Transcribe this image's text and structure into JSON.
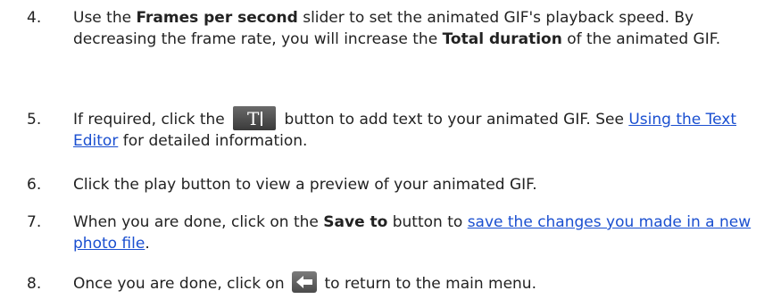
{
  "steps": [
    {
      "number": "4.",
      "parts": [
        "Use the ",
        "Frames per second",
        " slider to set the animated GIF's playback speed. By decreasing the frame rate, you will increase the ",
        "Total duration",
        " of the animated GIF."
      ]
    },
    {
      "number": "5.",
      "parts": [
        "If required, click the ",
        " button to add text to your animated GIF. See ",
        "Using the Text Editor",
        " for detailed information."
      ],
      "icon": "text-tool-icon"
    },
    {
      "number": "6.",
      "parts": [
        "Click the play button to view a preview of your animated GIF."
      ]
    },
    {
      "number": "7.",
      "parts": [
        "When you are done, click on the ",
        "Save to",
        " button to ",
        "save the changes you made in a new photo file",
        "."
      ]
    },
    {
      "number": "8.",
      "parts": [
        "Once you are done, click on ",
        " to return to the main menu."
      ],
      "icon": "back-arrow-icon"
    }
  ],
  "colors": {
    "text": "#222222",
    "link": "#1a4fd0"
  }
}
